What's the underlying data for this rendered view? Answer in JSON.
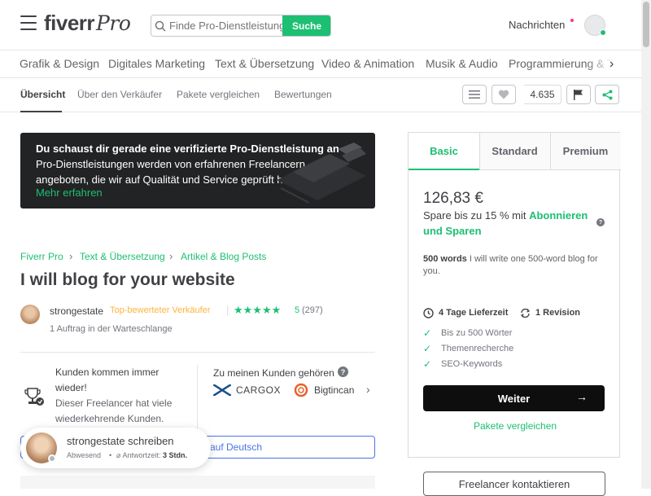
{
  "header": {
    "logo": "fiverr",
    "logo_suffix": "Pro",
    "search_placeholder": "Finde Pro-Dienstleistungen",
    "search_button": "Suche",
    "messages": "Nachrichten"
  },
  "categories": [
    "Grafik & Design",
    "Digitales Marketing",
    "Text & Übersetzung",
    "Video & Animation",
    "Musik & Audio",
    "Programmierung & Tech"
  ],
  "subnav": {
    "tabs": [
      "Übersicht",
      "Über den Verkäufer",
      "Pakete vergleichen",
      "Bewertungen"
    ],
    "like_count": "4.635"
  },
  "banner": {
    "text_bold": "Du schaust dir gerade eine verifizierte Pro-Dienstleistung an",
    "text_rest": "Pro-Dienstleistungen werden von erfahrenen Freelancern angeboten, die wir auf Qualität und Service geprüft haben.",
    "link": "Mehr erfahren"
  },
  "breadcrumb": [
    "Fiverr Pro",
    "Text & Übersetzung",
    "Artikel & Blog Posts"
  ],
  "gig": {
    "title": "I will blog for your website",
    "seller_name": "strongestate",
    "seller_level": "Top-bewerteter Verkäufer",
    "rating_score": "5",
    "rating_count": "(297)",
    "queue": "1 Auftrag in der Warteschlange"
  },
  "info": {
    "repeat_title": "Kunden kommen immer wieder!",
    "repeat_desc": "Dieser Freelancer hat viele wiederkehrende Kunden.",
    "clients_title": "Zu meinen Kunden gehören",
    "clients": [
      "CARGOX",
      "Bigtincan"
    ],
    "translate": "auf Deutsch"
  },
  "chat": {
    "name": "strongestate schreiben",
    "status": "Abwesend",
    "response_label": "Antwortzeit:",
    "response_value": "3 Stdn."
  },
  "package": {
    "tabs": [
      "Basic",
      "Standard",
      "Premium"
    ],
    "price": "126,83 €",
    "save_prefix": "Spare bis zu 15 % mit",
    "save_link": "Abonnieren und Sparen",
    "desc_bold": "500 words",
    "desc_rest": "I will write one 500-word blog for you.",
    "delivery": "4 Tage Lieferzeit",
    "revisions": "1 Revision",
    "features": [
      "Bis zu 500 Wörter",
      "Themenrecherche",
      "SEO-Keywords"
    ],
    "continue": "Weiter",
    "compare": "Pakete vergleichen",
    "contact": "Freelancer kontaktieren"
  },
  "colors": {
    "brand_green": "#1dbf73",
    "text_dark": "#404145",
    "link_blue": "#4a73e8",
    "level_orange": "#ffb33e"
  }
}
